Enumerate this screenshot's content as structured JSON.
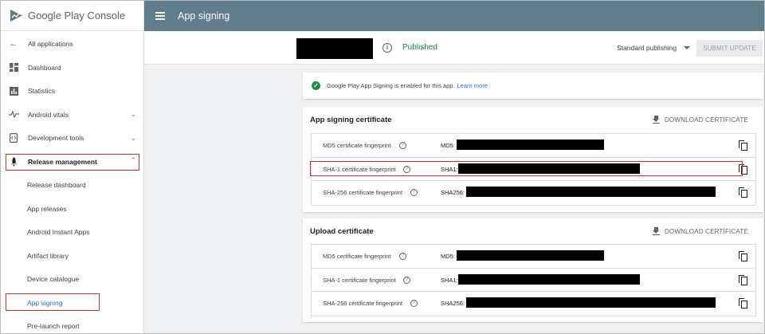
{
  "sidebar": {
    "logo_text": "Google Play Console",
    "back_label": "All applications",
    "items": [
      {
        "label": "Dashboard",
        "icon": "dashboard-icon"
      },
      {
        "label": "Statistics",
        "icon": "bar-chart-icon"
      },
      {
        "label": "Android vitals",
        "icon": "pulse-icon",
        "expandable": true
      },
      {
        "label": "Development tools",
        "icon": "code-icon",
        "expandable": true
      },
      {
        "label": "Release management",
        "icon": "rocket-icon",
        "expanded": true
      }
    ],
    "sub_items": [
      {
        "label": "Release dashboard"
      },
      {
        "label": "App releases"
      },
      {
        "label": "Android Instant Apps"
      },
      {
        "label": "Artifact library"
      },
      {
        "label": "Device catalogue"
      },
      {
        "label": "App signing",
        "active": true
      },
      {
        "label": "Pre-launch report"
      }
    ]
  },
  "topbar": {
    "title": "App signing"
  },
  "subheader": {
    "status": "Published",
    "publishing_mode": "Standard publishing",
    "submit_label": "SUBMIT UPDATE"
  },
  "banner": {
    "text": "Google Play App Signing is enabled for this app.",
    "link": "Learn more"
  },
  "app_signing_card": {
    "title": "App signing certificate",
    "download_label": "DOWNLOAD CERTIFICATE",
    "rows": [
      {
        "label": "MD5 certificate fingerprint",
        "alg": "MD5:"
      },
      {
        "label": "SHA-1 certificate fingerprint",
        "alg": "SHA1:"
      },
      {
        "label": "SHA-256 certificate fingerprint",
        "alg": "SHA256:"
      }
    ]
  },
  "upload_card": {
    "title": "Upload certificate",
    "download_label": "DOWNLOAD CERTIFICATE",
    "rows": [
      {
        "label": "MD5 certificate fingerprint",
        "alg": "MD5:"
      },
      {
        "label": "SHA-1 certificate fingerprint",
        "alg": "SHA1:"
      },
      {
        "label": "SHA-256 certificate fingerprint",
        "alg": "SHA256:"
      }
    ]
  },
  "colors": {
    "topbar": "#607d8b",
    "accent": "#1a73e8",
    "published": "#188038",
    "highlight": "#d93025"
  }
}
